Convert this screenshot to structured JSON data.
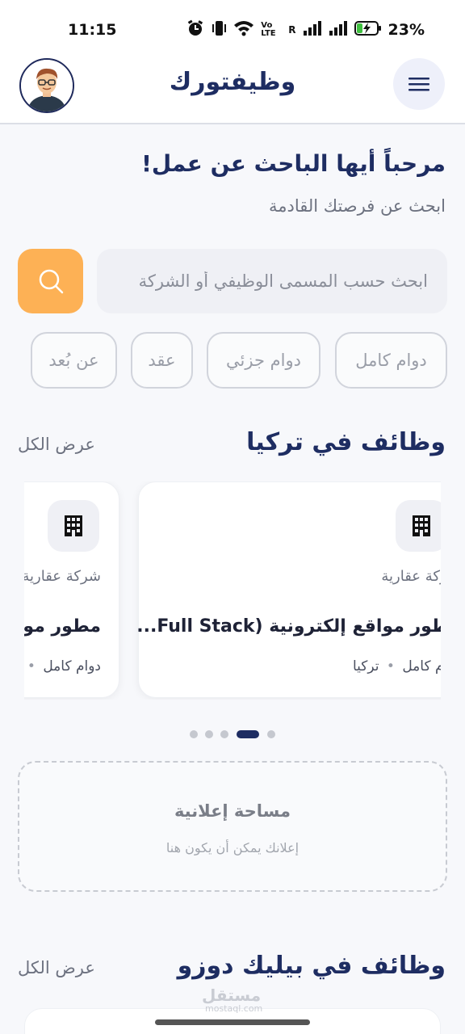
{
  "status_bar": {
    "time": "11:15",
    "battery": "23%",
    "network_label": "Vo LTE",
    "roaming": "R"
  },
  "header": {
    "app_title": "وظيفتورك"
  },
  "welcome": {
    "title": "مرحباً أيها الباحث عن عمل!",
    "subtitle": "ابحث عن فرصتك القادمة"
  },
  "search": {
    "placeholder": "ابحث حسب المسمى الوظيفي أو الشركة"
  },
  "filters": [
    "دوام كامل",
    "دوام جزئي",
    "عقد",
    "عن بُعد"
  ],
  "turkey_jobs": {
    "title": "وظائف في تركيا",
    "see_all": "عرض الكل",
    "cards": [
      {
        "company": "شركة عقارية",
        "title": "مطور مواقع إلكترونية (Full Stack...",
        "type": "دوام كامل",
        "location": "تركيا"
      },
      {
        "company": "شركة عقارية",
        "title": "مطور موا",
        "type": "دوام كامل",
        "location": ""
      }
    ],
    "pages": 5,
    "active_page": 4
  },
  "ad": {
    "title": "مساحة إعلانية",
    "subtitle": "إعلانك يمكن أن يكون هنا"
  },
  "beylikduzu_jobs": {
    "title": "وظائف في بيليك دوزو",
    "see_all": "عرض الكل"
  },
  "watermark": {
    "brand": "مستقل",
    "domain": "mostaql.com"
  },
  "colors": {
    "primary": "#1e2d62",
    "accent": "#fdb155",
    "background": "#f7f8fb"
  }
}
